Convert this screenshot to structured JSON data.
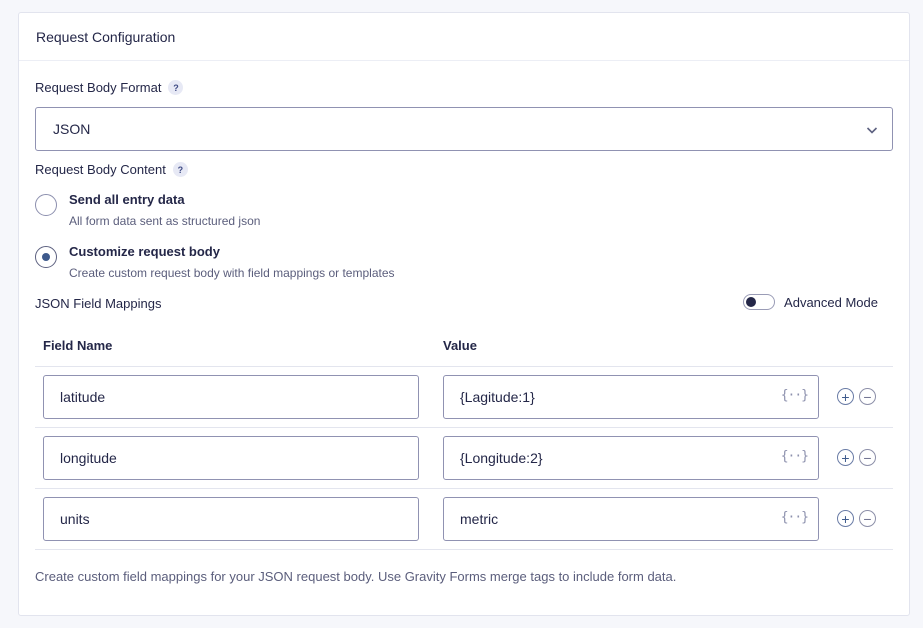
{
  "panel": {
    "title": "Request Configuration"
  },
  "body_format": {
    "label": "Request Body Format",
    "help": "?",
    "selected": "JSON"
  },
  "body_content": {
    "label": "Request Body Content",
    "help": "?",
    "options": [
      {
        "title": "Send all entry data",
        "desc": "All form data sent as structured json",
        "checked": false
      },
      {
        "title": "Customize request body",
        "desc": "Create custom request body with field mappings or templates",
        "checked": true
      }
    ]
  },
  "mappings": {
    "label": "JSON Field Mappings",
    "advanced_mode_label": "Advanced Mode",
    "advanced_mode_on": false,
    "col_field": "Field Name",
    "col_value": "Value",
    "merge_icon": "{··}",
    "add_glyph": "+",
    "remove_glyph": "−",
    "rows": [
      {
        "field": "latitude",
        "value": "{Lagitude:1}"
      },
      {
        "field": "longitude",
        "value": "{Longitude:2}"
      },
      {
        "field": "units",
        "value": "metric"
      }
    ],
    "note": "Create custom field mappings for your JSON request body. Use Gravity Forms merge tags to include form data."
  },
  "colors": {
    "accent": "#3e5a8c",
    "border": "#9092b2",
    "text": "#242748"
  }
}
